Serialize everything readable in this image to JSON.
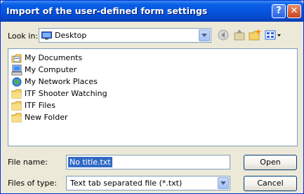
{
  "window": {
    "title": "Import of the user-defined form settings",
    "help_label": "?",
    "close_label": "✕"
  },
  "look_in": {
    "label": "Look in:",
    "value": "Desktop"
  },
  "items": [
    {
      "label": "My Documents",
      "icon": "my-documents-icon"
    },
    {
      "label": "My Computer",
      "icon": "my-computer-icon"
    },
    {
      "label": "My Network Places",
      "icon": "network-places-icon"
    },
    {
      "label": "ITF Shooter Watching",
      "icon": "folder-icon"
    },
    {
      "label": "ITF Files",
      "icon": "folder-icon"
    },
    {
      "label": "New Folder",
      "icon": "folder-icon"
    }
  ],
  "file_name": {
    "label": "File name:",
    "value": "No title.txt"
  },
  "file_type": {
    "label": "Files of type:",
    "value": "Text tab separated file (*.txt)"
  },
  "buttons": {
    "open": "Open",
    "cancel": "Cancel"
  },
  "colors": {
    "titlebar": "#0553dd",
    "dialog_bg": "#ece9d8",
    "selection": "#316ac5"
  }
}
